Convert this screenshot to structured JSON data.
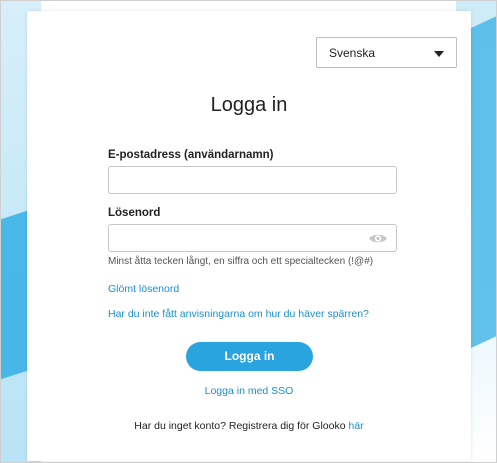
{
  "language_selector": {
    "selected": "Svenska"
  },
  "login_form": {
    "title": "Logga in",
    "email_label": "E-postadress (användarnamn)",
    "email_value": "",
    "password_label": "Lösenord",
    "password_value": "",
    "password_hint": "Minst åtta tecken långt, en siffra och ett specialtecken (!@#)",
    "forgot_password_link": "Glömt lösenord",
    "unlock_instructions_link": "Har du inte fått anvisningarna om hur du häver spärren?",
    "login_button": "Logga in",
    "sso_link": "Logga in med SSO",
    "register_text": "Har du inget konto? Registrera dig för Glooko ",
    "register_link": "här"
  },
  "icons": {
    "dropdown": "caret-down-icon",
    "show_password": "eye-icon"
  },
  "colors": {
    "accent": "#2aa4df",
    "link": "#1a8fcf",
    "background_wave": "#3bb1e5"
  }
}
